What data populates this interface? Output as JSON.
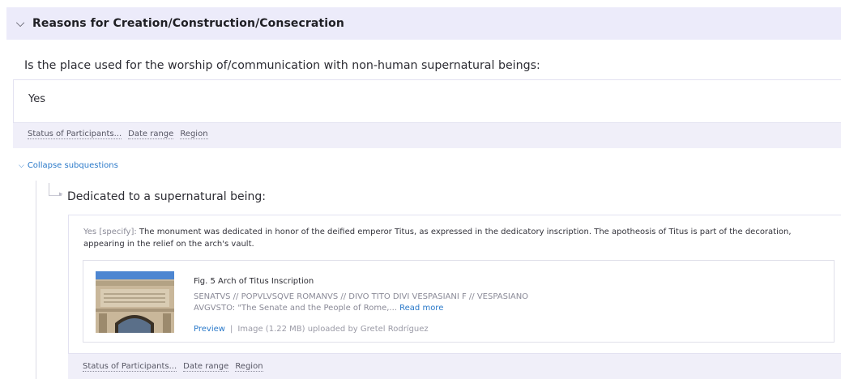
{
  "section": {
    "title": "Reasons for Creation/Construction/Consecration"
  },
  "question": {
    "text": "Is the place used for the worship of/communication with non-human supernatural beings:",
    "answer": "Yes",
    "tags": [
      "Status of Participants...",
      "Date range",
      "Region"
    ]
  },
  "collapse_label": "Collapse subquestions",
  "subquestion": {
    "text": "Dedicated to a supernatural being:",
    "specify_label": "Yes [specify]:",
    "specify_text": " The monument was dedicated in honor of the deified emperor Titus, as expressed in the dedicatory inscription. The apotheosis of Titus is part of the decoration, appearing in the relief on the arch's vault.",
    "media": {
      "title": "Fig. 5 Arch of Titus Inscription",
      "description": "SENATVS // POPVLVSQVE ROMANVS // DIVO TITO DIVI VESPASIANI F // VESPASIANO AVGVSTO: \"The Senate and the People of Rome,...",
      "read_more": "Read more",
      "preview": "Preview",
      "separator": "|",
      "meta": "Image (1.22 MB) uploaded by Gretel Rodríguez"
    },
    "tags": [
      "Status of Participants...",
      "Date range",
      "Region"
    ]
  }
}
